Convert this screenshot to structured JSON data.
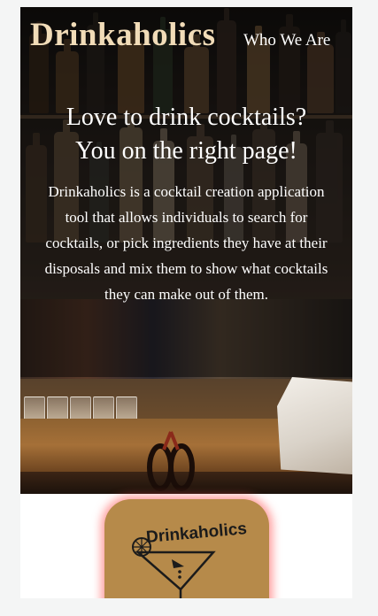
{
  "header": {
    "brand": "Drinkaholics",
    "nav_link": "Who We Are"
  },
  "hero": {
    "title_line1": "Love to drink cocktails?",
    "title_line2": "You on the right page!",
    "description": "Drinkaholics is a cocktail creation application tool that allows individuals to search for cocktails, or pick ingredients they have at their disposals and mix them to show what cocktails they can make out of them."
  },
  "logo": {
    "text": "Drinkaholics"
  },
  "colors": {
    "brand_text": "#f1dcb8",
    "logo_bg": "#b68a4a",
    "logo_glow": "#ff5050",
    "page_bg": "#f4f5f5"
  }
}
